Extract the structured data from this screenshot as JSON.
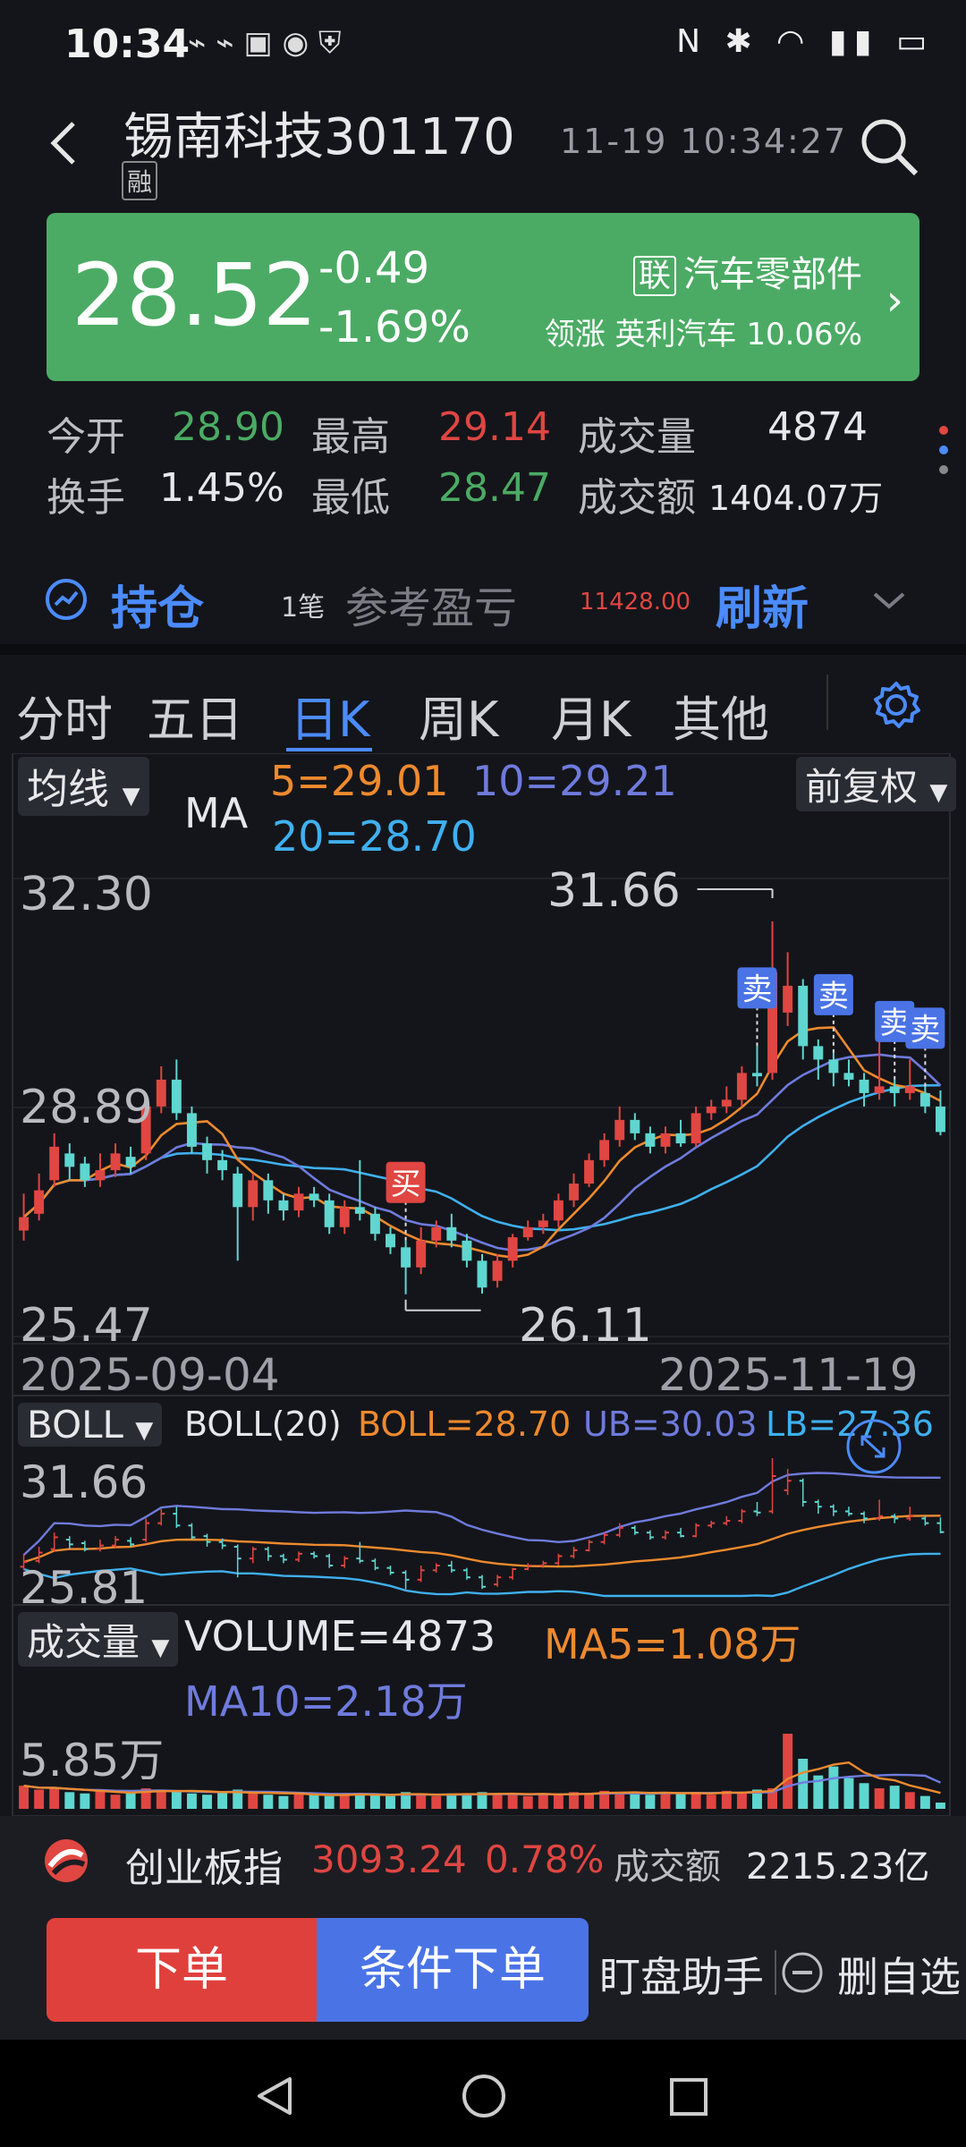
{
  "status_bar": {
    "time": "10:34"
  },
  "header": {
    "stock_title": "锡南科技301170",
    "margin_badge": "融",
    "timestamp": "11-19 10:34:27"
  },
  "quote": {
    "price": "28.52",
    "change": "-0.49",
    "change_pct": "-1.69%",
    "sector_badge": "联",
    "sector_name": "汽车零部件",
    "leader_text": "领涨 英利汽车 10.06%"
  },
  "stats": {
    "open_label": "今开",
    "open_value": "28.90",
    "high_label": "最高",
    "high_value": "29.14",
    "volume_label": "成交量",
    "volume_value": "4874",
    "turnover_label": "换手",
    "turnover_value": "1.45%",
    "low_label": "最低",
    "low_value": "28.47",
    "amount_label": "成交额",
    "amount_value": "1404.07万"
  },
  "position": {
    "label": "持仓",
    "count": "1笔",
    "ref_label": "参考盈亏",
    "ref_value": "11428.00",
    "refresh": "刷新"
  },
  "tabs": [
    "分时",
    "五日",
    "日K",
    "周K",
    "月K",
    "其他"
  ],
  "active_tab": 2,
  "kline": {
    "indicator_dropdown": "均线",
    "adjust_dropdown": "前复权",
    "ma_label": "MA",
    "ma5": "5=29.01",
    "ma10": "10=29.21",
    "ma20": "20=28.70",
    "price_top": "32.30",
    "price_mid": "28.89",
    "price_bottom": "25.47",
    "high_marker": "31.66",
    "low_marker": "26.11",
    "date_start": "2025-09-04",
    "date_end": "2025-11-19",
    "buy_label": "买",
    "sell_label": "卖"
  },
  "boll": {
    "dropdown": "BOLL",
    "label": "BOLL(20)",
    "mid": "BOLL=28.70",
    "ub": "UB=30.03",
    "lb": "LB=27.36",
    "axis_top": "31.66",
    "axis_bottom": "25.81"
  },
  "volume": {
    "dropdown": "成交量",
    "volume": "VOLUME=4873",
    "ma5": "MA5=1.08万",
    "ma10": "MA10=2.18万",
    "axis_top": "5.85万"
  },
  "index_bar": {
    "name": "创业板指",
    "value": "3093.24",
    "pct": "0.78%",
    "amount_label": "成交额",
    "amount_value": "2215.23亿"
  },
  "actions": {
    "order": "下单",
    "conditional_order": "条件下单",
    "assistant": "盯盘助手",
    "remove_watch": "删自选"
  },
  "colors": {
    "up": "#e04642",
    "down": "#5fd6d0",
    "ma5": "#ee8a2e",
    "ma10": "#6f7bdc",
    "ma20": "#3fb0ef",
    "accent": "#4b8bff",
    "price_card": "#4bab64"
  },
  "chart_data": {
    "type": "candlestick",
    "candles": [
      {
        "o": 27.05,
        "c": 27.25,
        "h": 27.6,
        "l": 26.9
      },
      {
        "o": 27.3,
        "c": 27.65,
        "h": 27.9,
        "l": 27.2
      },
      {
        "o": 27.8,
        "c": 28.3,
        "h": 28.5,
        "l": 27.7
      },
      {
        "o": 28.2,
        "c": 28.0,
        "h": 28.35,
        "l": 27.8
      },
      {
        "o": 28.05,
        "c": 27.8,
        "h": 28.15,
        "l": 27.7
      },
      {
        "o": 27.8,
        "c": 27.95,
        "h": 28.2,
        "l": 27.7
      },
      {
        "o": 27.95,
        "c": 28.2,
        "h": 28.35,
        "l": 27.85
      },
      {
        "o": 28.15,
        "c": 28.0,
        "h": 28.3,
        "l": 27.9
      },
      {
        "o": 28.2,
        "c": 28.9,
        "h": 29.1,
        "l": 28.1
      },
      {
        "o": 28.9,
        "c": 29.3,
        "h": 29.5,
        "l": 28.8
      },
      {
        "o": 29.3,
        "c": 28.8,
        "h": 29.6,
        "l": 28.7
      },
      {
        "o": 28.8,
        "c": 28.3,
        "h": 28.9,
        "l": 28.2
      },
      {
        "o": 28.35,
        "c": 28.1,
        "h": 28.45,
        "l": 27.9
      },
      {
        "o": 28.1,
        "c": 27.95,
        "h": 28.25,
        "l": 27.8
      },
      {
        "o": 27.9,
        "c": 27.4,
        "h": 28.0,
        "l": 26.6
      },
      {
        "o": 27.4,
        "c": 27.8,
        "h": 27.9,
        "l": 27.2
      },
      {
        "o": 27.8,
        "c": 27.5,
        "h": 27.9,
        "l": 27.3
      },
      {
        "o": 27.5,
        "c": 27.35,
        "h": 27.6,
        "l": 27.2
      },
      {
        "o": 27.35,
        "c": 27.6,
        "h": 27.7,
        "l": 27.25
      },
      {
        "o": 27.6,
        "c": 27.5,
        "h": 27.7,
        "l": 27.4
      },
      {
        "o": 27.5,
        "c": 27.1,
        "h": 27.6,
        "l": 27.0
      },
      {
        "o": 27.1,
        "c": 27.4,
        "h": 27.5,
        "l": 27.0
      },
      {
        "o": 27.4,
        "c": 27.3,
        "h": 28.1,
        "l": 27.2
      },
      {
        "o": 27.3,
        "c": 27.0,
        "h": 27.4,
        "l": 26.9
      },
      {
        "o": 27.0,
        "c": 26.8,
        "h": 27.1,
        "l": 26.7
      },
      {
        "o": 26.8,
        "c": 26.5,
        "h": 26.9,
        "l": 26.1
      },
      {
        "o": 26.5,
        "c": 26.9,
        "h": 27.1,
        "l": 26.4
      },
      {
        "o": 26.9,
        "c": 27.1,
        "h": 27.2,
        "l": 26.8
      },
      {
        "o": 27.1,
        "c": 26.9,
        "h": 27.3,
        "l": 26.8
      },
      {
        "o": 26.9,
        "c": 26.6,
        "h": 27.0,
        "l": 26.5
      },
      {
        "o": 26.6,
        "c": 26.2,
        "h": 26.7,
        "l": 26.11
      },
      {
        "o": 26.3,
        "c": 26.6,
        "h": 26.7,
        "l": 26.2
      },
      {
        "o": 26.6,
        "c": 26.95,
        "h": 27.0,
        "l": 26.5
      },
      {
        "o": 26.95,
        "c": 27.1,
        "h": 27.2,
        "l": 26.9
      },
      {
        "o": 27.1,
        "c": 27.2,
        "h": 27.3,
        "l": 27.0
      },
      {
        "o": 27.2,
        "c": 27.5,
        "h": 27.6,
        "l": 27.1
      },
      {
        "o": 27.5,
        "c": 27.75,
        "h": 27.9,
        "l": 27.4
      },
      {
        "o": 27.75,
        "c": 28.1,
        "h": 28.2,
        "l": 27.7
      },
      {
        "o": 28.1,
        "c": 28.4,
        "h": 28.5,
        "l": 28.0
      },
      {
        "o": 28.4,
        "c": 28.7,
        "h": 28.9,
        "l": 28.3
      },
      {
        "o": 28.7,
        "c": 28.5,
        "h": 28.8,
        "l": 28.4
      },
      {
        "o": 28.5,
        "c": 28.3,
        "h": 28.6,
        "l": 28.2
      },
      {
        "o": 28.3,
        "c": 28.5,
        "h": 28.6,
        "l": 28.2
      },
      {
        "o": 28.5,
        "c": 28.35,
        "h": 28.7,
        "l": 28.3
      },
      {
        "o": 28.35,
        "c": 28.8,
        "h": 28.9,
        "l": 28.3
      },
      {
        "o": 28.8,
        "c": 28.9,
        "h": 29.0,
        "l": 28.7
      },
      {
        "o": 28.9,
        "c": 29.0,
        "h": 29.2,
        "l": 28.8
      },
      {
        "o": 29.0,
        "c": 29.4,
        "h": 29.5,
        "l": 28.9
      },
      {
        "o": 29.4,
        "c": 29.35,
        "h": 29.8,
        "l": 29.2
      },
      {
        "o": 29.4,
        "c": 30.9,
        "h": 31.66,
        "l": 29.3
      },
      {
        "o": 30.3,
        "c": 30.7,
        "h": 31.2,
        "l": 30.1
      },
      {
        "o": 30.7,
        "c": 29.8,
        "h": 30.8,
        "l": 29.6
      },
      {
        "o": 29.8,
        "c": 29.6,
        "h": 29.9,
        "l": 29.3
      },
      {
        "o": 29.6,
        "c": 29.4,
        "h": 29.7,
        "l": 29.2
      },
      {
        "o": 29.4,
        "c": 29.3,
        "h": 29.6,
        "l": 29.2
      },
      {
        "o": 29.3,
        "c": 29.1,
        "h": 29.4,
        "l": 28.9
      },
      {
        "o": 29.1,
        "c": 29.2,
        "h": 29.9,
        "l": 29.0
      },
      {
        "o": 29.2,
        "c": 29.1,
        "h": 29.3,
        "l": 28.9
      },
      {
        "o": 29.1,
        "c": 29.2,
        "h": 29.6,
        "l": 29.0
      },
      {
        "o": 29.1,
        "c": 28.9,
        "h": 29.2,
        "l": 28.8
      },
      {
        "o": 28.9,
        "c": 28.52,
        "h": 29.14,
        "l": 28.47
      }
    ],
    "volumes": [
      1.8,
      1.5,
      1.6,
      1.3,
      1.2,
      1.4,
      1.1,
      1.3,
      1.6,
      1.5,
      1.4,
      1.2,
      1.1,
      1.3,
      1.5,
      1.2,
      1.1,
      1.0,
      1.2,
      1.1,
      1.0,
      1.1,
      1.2,
      1.1,
      1.0,
      1.3,
      1.1,
      1.0,
      1.2,
      1.1,
      1.3,
      1.2,
      1.1,
      1.0,
      1.2,
      1.1,
      1.3,
      1.2,
      1.4,
      1.3,
      1.2,
      1.1,
      1.3,
      1.2,
      1.3,
      1.1,
      1.4,
      1.3,
      1.5,
      1.6,
      5.85,
      3.9,
      2.6,
      3.3,
      2.4,
      2.0,
      1.6,
      1.8,
      1.3,
      1.0,
      0.49
    ],
    "buy_index": 25,
    "sell_indices": [
      48,
      53,
      57,
      59
    ],
    "ylim": [
      25.47,
      32.3
    ]
  }
}
